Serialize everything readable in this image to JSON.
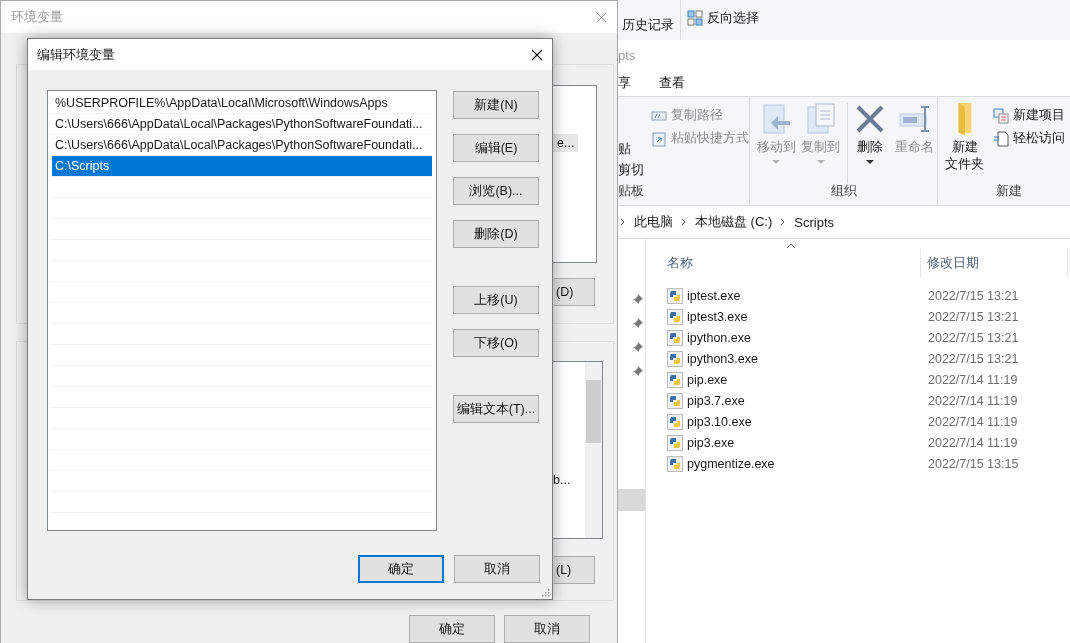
{
  "explorer_top": {
    "items": [
      {
        "kind": "history",
        "label": "历史记录"
      },
      {
        "kind": "invert",
        "label": "反向选择"
      }
    ]
  },
  "explorer": {
    "title": "pts",
    "tabs": [
      {
        "label": "享",
        "selected": false
      },
      {
        "label": "查看",
        "selected": false
      }
    ],
    "clipboard": {
      "paste": "贴",
      "cut": "剪切",
      "items": [
        {
          "kind": "path",
          "label": "复制路径"
        },
        {
          "kind": "shortcut",
          "label": "粘贴快捷方式"
        }
      ],
      "group": "贴板"
    },
    "organize": {
      "items": [
        {
          "kind": "move",
          "label": "移动到",
          "disabled": true,
          "dropdown": true
        },
        {
          "kind": "copy",
          "label": "复制到",
          "disabled": true,
          "dropdown": true
        },
        {
          "kind": "delete",
          "label": "删除",
          "disabled": false,
          "dropdown": true
        },
        {
          "kind": "rename",
          "label": "重命名",
          "disabled": true,
          "dropdown": false
        }
      ],
      "group": "组织"
    },
    "new": {
      "folder": [
        "新建",
        "文件夹"
      ],
      "items": [
        {
          "kind": "item",
          "label": "新建项目"
        },
        {
          "kind": "access",
          "label": "轻松访问"
        }
      ],
      "group": "新建"
    },
    "address": [
      "此电脑",
      "本地磁盘 (C:)",
      "Scripts"
    ],
    "columns": [
      "名称",
      "修改日期"
    ],
    "files": [
      {
        "name": "iptest.exe",
        "modified": "2022/7/15 13:21"
      },
      {
        "name": "iptest3.exe",
        "modified": "2022/7/15 13:21"
      },
      {
        "name": "ipython.exe",
        "modified": "2022/7/15 13:21"
      },
      {
        "name": "ipython3.exe",
        "modified": "2022/7/15 13:21"
      },
      {
        "name": "pip.exe",
        "modified": "2022/7/14 11:19"
      },
      {
        "name": "pip3.7.exe",
        "modified": "2022/7/14 11:19"
      },
      {
        "name": "pip3.10.exe",
        "modified": "2022/7/14 11:19"
      },
      {
        "name": "pip3.exe",
        "modified": "2022/7/14 11:19"
      },
      {
        "name": "pygmentize.exe",
        "modified": "2022/7/15 13:15"
      }
    ]
  },
  "env_dialog": {
    "title": "环境变量",
    "user_list_fragment": "e...",
    "user_button_fragment": "(D)",
    "system_list_fragment": "b...",
    "system_button_fragment": "(L)",
    "buttons": [
      "确定",
      "取消"
    ]
  },
  "edit_dialog": {
    "title": "编辑环境变量",
    "paths": [
      {
        "text": "%USERPROFILE%\\AppData\\Local\\Microsoft\\WindowsApps",
        "selected": false
      },
      {
        "text": "C:\\Users\\666\\AppData\\Local\\Packages\\PythonSoftwareFoundati...",
        "selected": false
      },
      {
        "text": "C:\\Users\\666\\AppData\\Local\\Packages\\PythonSoftwareFoundati...",
        "selected": false
      },
      {
        "text": "C:\\Scripts",
        "selected": true
      }
    ],
    "side_button_groups": [
      [
        "新建(N)",
        "编辑(E)",
        "浏览(B)...",
        "删除(D)"
      ],
      [
        "上移(U)",
        "下移(O)"
      ],
      [
        "编辑文本(T)..."
      ]
    ],
    "footer_buttons": [
      {
        "label": "确定",
        "default": true
      },
      {
        "label": "取消",
        "default": false
      }
    ]
  }
}
